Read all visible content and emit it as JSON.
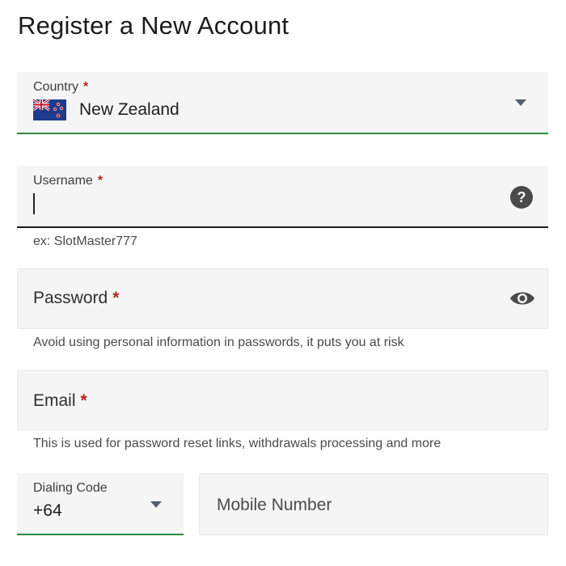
{
  "page_title": "Register a New Account",
  "country": {
    "label": "Country",
    "required_mark": "*",
    "value": "New Zealand",
    "flag_icon": "new-zealand-flag-icon"
  },
  "username": {
    "label": "Username",
    "required_mark": "*",
    "value": "",
    "helper": "ex: SlotMaster777",
    "help_icon": "question-mark-icon"
  },
  "password": {
    "label": "Password",
    "required_mark": "*",
    "helper": "Avoid using personal information in passwords, it puts you at risk",
    "toggle_icon": "eye-icon"
  },
  "email": {
    "label": "Email",
    "required_mark": "*",
    "helper": "This is used for password reset links, withdrawals processing and more"
  },
  "dialing_code": {
    "label": "Dialing Code",
    "value": "+64"
  },
  "mobile": {
    "placeholder": "Mobile Number"
  },
  "colors": {
    "accent_green": "#2e8b3a",
    "required_red": "#b3261e",
    "field_background": "#f5f5f5"
  }
}
